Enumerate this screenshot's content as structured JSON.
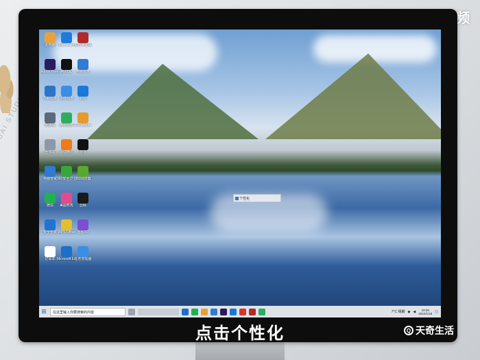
{
  "watermark_top": "天奇·视频",
  "caption": "点击个性化",
  "brand_bottom": "天奇生活",
  "desktop": {
    "icons": [
      {
        "label": "此电脑",
        "color": "#e8a23a"
      },
      {
        "label": "ManyCam",
        "color": "#1f7ae0"
      },
      {
        "label": "剪映专业版",
        "color": "#b22a2a"
      },
      {
        "label": "Adobe Premiere",
        "color": "#2b1a5c"
      },
      {
        "label": "腾讯QQ",
        "color": "#111111"
      },
      {
        "label": "电脑管家",
        "color": "#2f7bd6"
      },
      {
        "label": "控制面板",
        "color": "#2d74c9"
      },
      {
        "label": "百度网盘",
        "color": "#3a8ee6"
      },
      {
        "label": "钉钉",
        "color": "#1a79d8"
      },
      {
        "label": "回收站",
        "color": "#5a6a7a"
      },
      {
        "label": "腾讯视频",
        "color": "#2cae5e"
      },
      {
        "label": "EVCapture",
        "color": "#e59a2e"
      },
      {
        "label": "回收站",
        "color": "#8a98a8"
      },
      {
        "label": "驱动精灵",
        "color": "#f07b1a"
      },
      {
        "label": "抖音",
        "color": "#111111"
      },
      {
        "label": "电脑管家",
        "color": "#2e7bd0"
      },
      {
        "label": "360安全卫士",
        "color": "#3aa63a"
      },
      {
        "label": "360浏览器",
        "color": "#5aa82e"
      },
      {
        "label": "微信",
        "color": "#23b14d"
      },
      {
        "label": "美图秀秀",
        "color": "#e44b8d"
      },
      {
        "label": "剪映",
        "color": "#1a1a1a"
      },
      {
        "label": "安全管家",
        "color": "#1f73d1"
      },
      {
        "label": "WPS Office",
        "color": "#e2c02a"
      },
      {
        "label": "画图3D",
        "color": "#7a4fd1"
      },
      {
        "label": "记事本",
        "color": "#ffffff"
      },
      {
        "label": "Microsoft Edge",
        "color": "#1d6fc9"
      },
      {
        "label": "任务管理器",
        "color": "#3a8ee6"
      }
    ],
    "tooltip": "个性化"
  },
  "taskbar": {
    "search_placeholder": "在这里输入你要搜索的内容",
    "weather": "7°C 晴朗",
    "time": "19:09",
    "date": "2022/1/18"
  }
}
